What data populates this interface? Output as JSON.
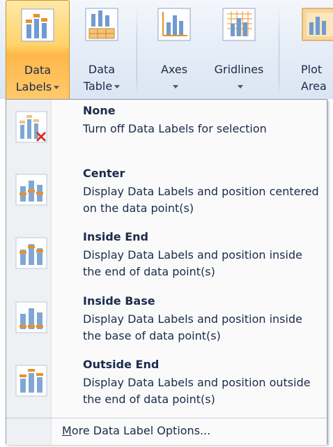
{
  "ribbon": {
    "buttons": [
      {
        "line1": "Data",
        "line2": "Labels",
        "icon": "data-labels-icon",
        "active": true
      },
      {
        "line1": "Data",
        "line2": "Table",
        "icon": "data-table-icon"
      },
      {
        "line1": "Axes",
        "line2": "",
        "icon": "axes-icon"
      },
      {
        "line1": "Gridlines",
        "line2": "",
        "icon": "gridlines-icon"
      },
      {
        "line1": "Plot",
        "line2": "Area",
        "icon": "plot-area-icon"
      }
    ]
  },
  "menu": {
    "items": [
      {
        "title": "None",
        "desc": "Turn off Data Labels for selection",
        "icon": "no-labels-icon"
      },
      {
        "title": "Center",
        "desc": "Display Data Labels and position centered on the data point(s)",
        "icon": "center-labels-icon"
      },
      {
        "title": "Inside End",
        "desc": "Display Data Labels and position inside the end of data point(s)",
        "icon": "inside-end-labels-icon"
      },
      {
        "title": "Inside Base",
        "desc": "Display Data Labels and position inside the base of data point(s)",
        "icon": "inside-base-labels-icon"
      },
      {
        "title": "Outside End",
        "desc": "Display Data Labels and position outside the end of data point(s)",
        "icon": "outside-end-labels-icon"
      }
    ],
    "more_options_first": "M",
    "more_options_rest": "ore Data Label Options..."
  },
  "colors": {
    "accent": "#ffc45e",
    "bar_blue": "#7fa7d6",
    "label_orange": "#e8912a",
    "delete_red": "#d6322b"
  }
}
